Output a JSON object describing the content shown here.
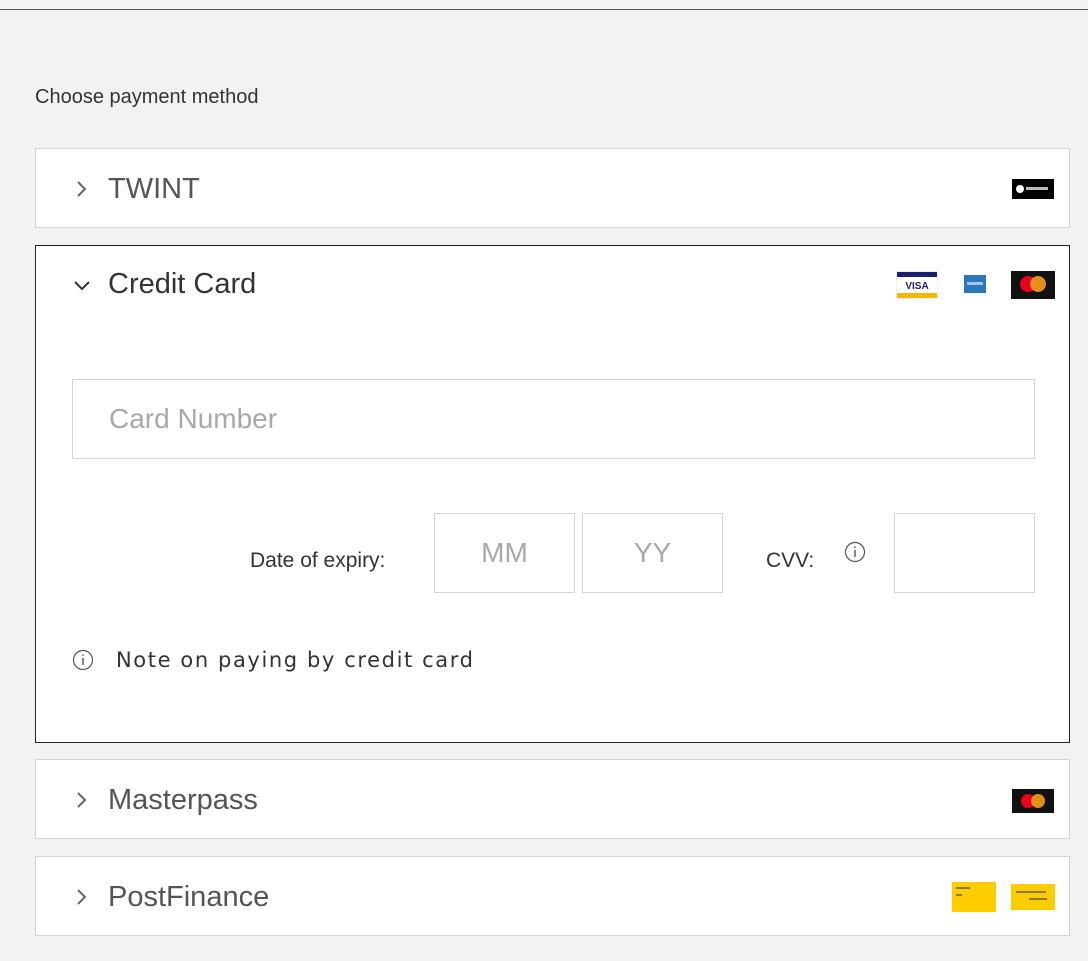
{
  "heading": "Choose payment method",
  "methods": [
    {
      "id": "twint",
      "label": "TWINT",
      "expanded": false,
      "logo_text": "TWINT"
    },
    {
      "id": "credit-card",
      "label": "Credit Card",
      "expanded": true,
      "logos": [
        "VISA",
        "American Express",
        "Mastercard"
      ]
    },
    {
      "id": "masterpass",
      "label": "Masterpass",
      "expanded": false
    },
    {
      "id": "postfinance",
      "label": "PostFinance",
      "expanded": false
    }
  ],
  "credit_card": {
    "card_number_placeholder": "Card Number",
    "expiry_label": "Date of expiry:",
    "mm_placeholder": "MM",
    "yy_placeholder": "YY",
    "cvv_label": "CVV:",
    "note": "Note on paying by credit card",
    "visa_text": "VISA"
  },
  "icons": {
    "collapsed_chevron": "chevron-right-icon",
    "expanded_chevron": "chevron-down-icon",
    "info": "info-icon"
  },
  "colors": {
    "page_bg": "#f2f2f2",
    "panel_bg": "#ffffff",
    "border": "#d4d4d4",
    "active_border": "#222222",
    "placeholder": "#a8a8a8",
    "visa_blue": "#1a1f71",
    "visa_gold": "#f7b600",
    "mc_red": "#eb001b",
    "mc_orange": "#f79e1b",
    "amex_blue": "#2e77bc",
    "postfinance_yellow": "#ffcc00"
  }
}
